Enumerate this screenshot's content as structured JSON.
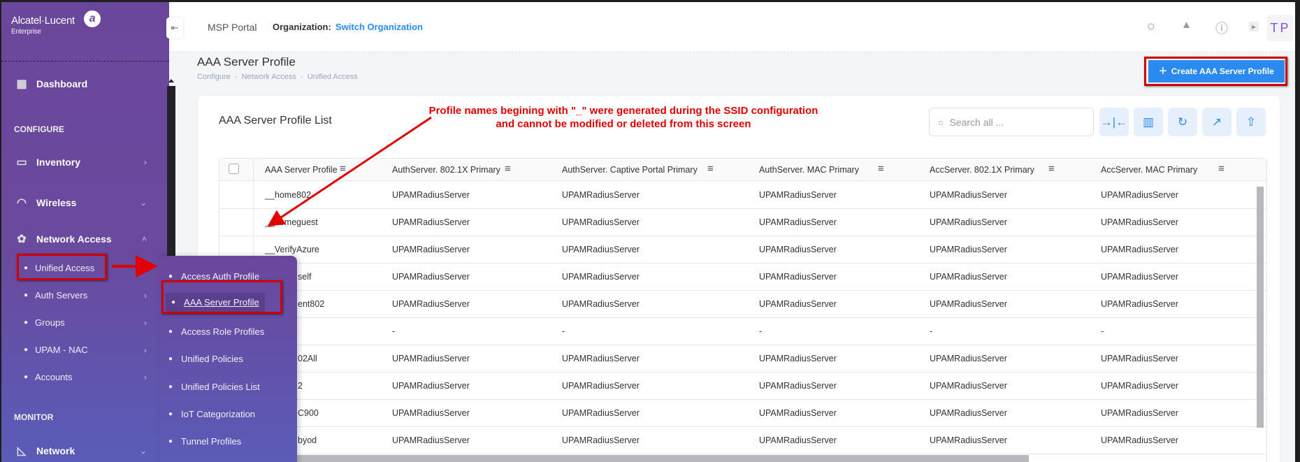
{
  "brand": {
    "name": "Alcatel·Lucent",
    "sub": "Enterprise"
  },
  "header": {
    "portal": "MSP Portal",
    "org_label": "Organization:",
    "org_link": "Switch Organization",
    "avatar": "TP",
    "icons": [
      "search-icon",
      "bell-icon",
      "help-icon",
      "video-icon"
    ]
  },
  "sidebar": {
    "dashboard": "Dashboard",
    "configure": "CONFIGURE",
    "inventory": "Inventory",
    "wireless": "Wireless",
    "network_access": "Network Access",
    "sub": [
      "Unified Access",
      "Auth Servers",
      "Groups",
      "UPAM - NAC",
      "Accounts"
    ],
    "monitor": "MONITOR",
    "network": "Network"
  },
  "flyout": [
    "Access Auth Profile",
    "AAA Server Profile",
    "Access Role Profiles",
    "Unified Policies",
    "Unified Policies List",
    "IoT Categorization",
    "Tunnel Profiles"
  ],
  "page": {
    "title": "AAA Server Profile",
    "breadcrumb": "Configure  -  Network Access  -  Unified Access",
    "create_label": "Create AAA Server Profile"
  },
  "card": {
    "title": "AAA Server Profile List",
    "search_placeholder": "Search all ...",
    "tools": [
      "collapse-columns-icon",
      "columns-icon",
      "refresh-icon",
      "open-external-icon",
      "export-icon"
    ]
  },
  "table": {
    "columns": [
      "AAA Server Profile",
      "AuthServer. 802.1X Primary",
      "AuthServer. Captive Portal Primary",
      "AuthServer. MAC Primary",
      "AccServer. 802.1X Primary",
      "AccServer. MAC Primary"
    ],
    "rows": [
      [
        "__home802",
        "UPAMRadiusServer",
        "UPAMRadiusServer",
        "UPAMRadiusServer",
        "UPAMRadiusServer",
        "UPAMRadiusServer"
      ],
      [
        "__homeguest",
        "UPAMRadiusServer",
        "UPAMRadiusServer",
        "UPAMRadiusServer",
        "UPAMRadiusServer",
        "UPAMRadiusServer"
      ],
      [
        "__VerifyAzure",
        "UPAMRadiusServer",
        "UPAMRadiusServer",
        "UPAMRadiusServer",
        "UPAMRadiusServer",
        "UPAMRadiusServer"
      ],
      [
        "self",
        "UPAMRadiusServer",
        "UPAMRadiusServer",
        "UPAMRadiusServer",
        "UPAMRadiusServer",
        "UPAMRadiusServer"
      ],
      [
        "ent802",
        "UPAMRadiusServer",
        "UPAMRadiusServer",
        "UPAMRadiusServer",
        "UPAMRadiusServer",
        "UPAMRadiusServer"
      ],
      [
        "",
        "-",
        "-",
        "-",
        "-",
        "-"
      ],
      [
        "02All",
        "UPAMRadiusServer",
        "UPAMRadiusServer",
        "UPAMRadiusServer",
        "UPAMRadiusServer",
        "UPAMRadiusServer"
      ],
      [
        "2",
        "UPAMRadiusServer",
        "UPAMRadiusServer",
        "UPAMRadiusServer",
        "UPAMRadiusServer",
        "UPAMRadiusServer"
      ],
      [
        "C900",
        "UPAMRadiusServer",
        "UPAMRadiusServer",
        "UPAMRadiusServer",
        "UPAMRadiusServer",
        "UPAMRadiusServer"
      ],
      [
        "byod",
        "UPAMRadiusServer",
        "UPAMRadiusServer",
        "UPAMRadiusServer",
        "UPAMRadiusServer",
        "UPAMRadiusServer"
      ]
    ]
  },
  "annotation": {
    "text": "Profile names begining with \"_\" were generated during the SSID configuration and cannot be modified or deleted from this screen",
    "color": "#e00000"
  },
  "colors": {
    "sidebar": "#6a4a9e",
    "accent": "#2b8af0",
    "highlight": "#cc0000"
  }
}
